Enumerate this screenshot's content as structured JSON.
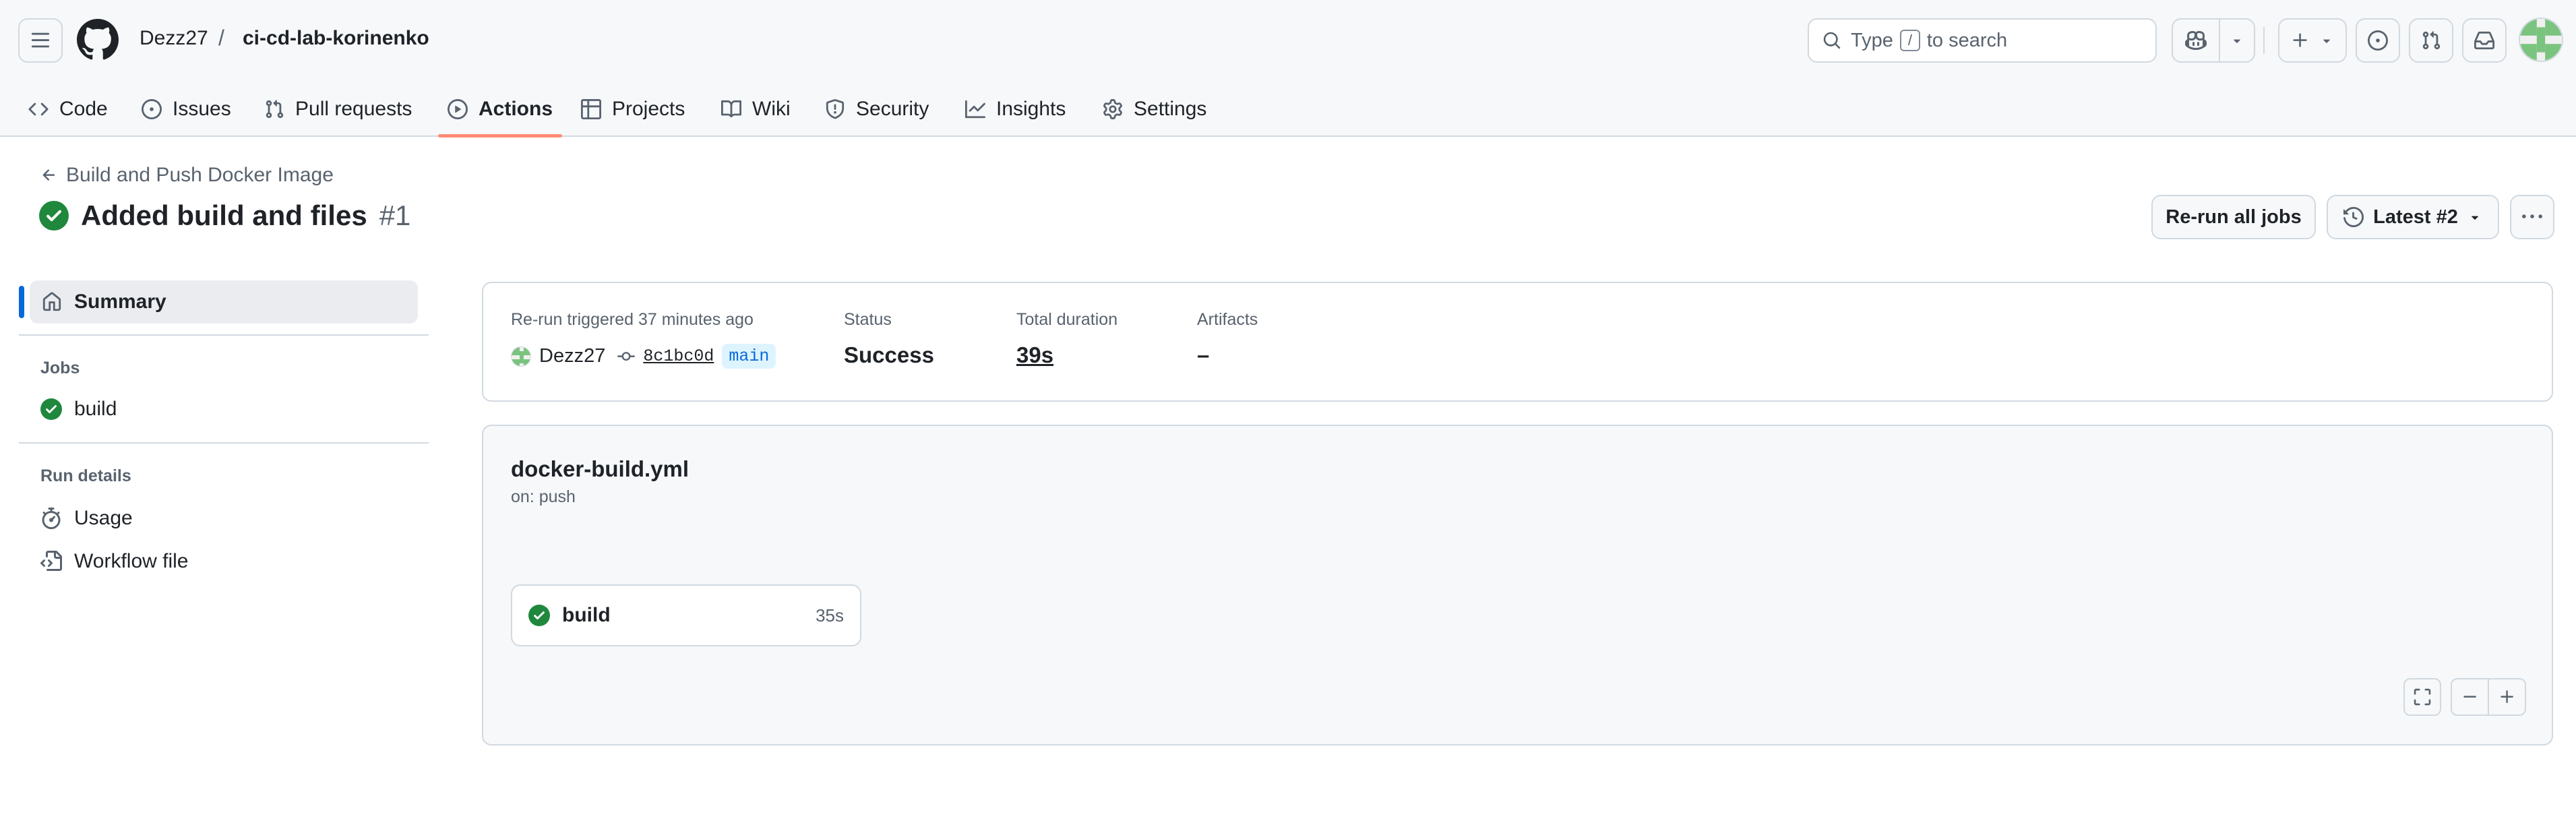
{
  "header": {
    "owner": "Dezz27",
    "separator": "/",
    "repo": "ci-cd-lab-korinenko",
    "search": {
      "before": "Type",
      "key": "/",
      "after": "to search"
    }
  },
  "repo_nav": {
    "tabs": [
      {
        "label": "Code",
        "icon": "code-icon"
      },
      {
        "label": "Issues",
        "icon": "issue-opened-icon"
      },
      {
        "label": "Pull requests",
        "icon": "git-pull-request-icon"
      },
      {
        "label": "Actions",
        "icon": "play-icon",
        "active": true
      },
      {
        "label": "Projects",
        "icon": "table-icon"
      },
      {
        "label": "Wiki",
        "icon": "book-icon"
      },
      {
        "label": "Security",
        "icon": "shield-icon"
      },
      {
        "label": "Insights",
        "icon": "graph-icon"
      },
      {
        "label": "Settings",
        "icon": "gear-icon"
      }
    ]
  },
  "page": {
    "workflow_link": "Build and Push Docker Image",
    "run_title": "Added build and files",
    "run_number": "#1",
    "rerun_label": "Re-run all jobs",
    "attempt_label": "Latest #2"
  },
  "sidebar": {
    "summary_label": "Summary",
    "jobs_heading": "Jobs",
    "jobs": [
      {
        "label": "build",
        "status": "success"
      }
    ],
    "details_heading": "Run details",
    "details": [
      {
        "label": "Usage",
        "icon": "stopwatch-icon"
      },
      {
        "label": "Workflow file",
        "icon": "file-code-icon"
      }
    ]
  },
  "summary": {
    "triggered_label": "Re-run triggered 37 minutes ago",
    "actor": "Dezz27",
    "commit_sha": "8c1bc0d",
    "branch": "main",
    "status_label": "Status",
    "status_value": "Success",
    "duration_label": "Total duration",
    "duration_value": "39s",
    "artifacts_label": "Artifacts",
    "artifacts_value": "–"
  },
  "workflow": {
    "file_name": "docker-build.yml",
    "trigger": "on: push",
    "jobs": [
      {
        "name": "build",
        "duration": "35s",
        "status": "success"
      }
    ]
  },
  "colors": {
    "success": "#1f883d",
    "accent_blue": "#0969da",
    "active_tab_underline": "#fd8c73"
  }
}
